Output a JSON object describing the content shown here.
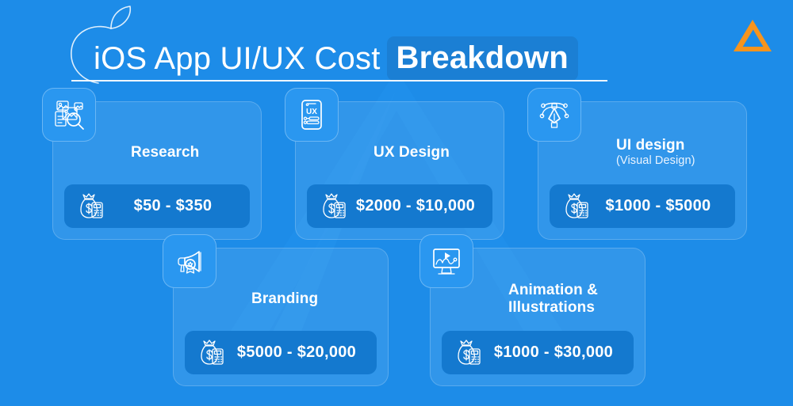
{
  "meta": {
    "background_color": "#1d8ce8",
    "accent_color": "#f7941d",
    "pill_color": "#1479cf",
    "icon_tile_color": "#2a97f0",
    "highlight_color": "#1b7fd4"
  },
  "header": {
    "apple_icon": "apple-logo-outline-icon",
    "title_light": "iOS App UI/UX Cost",
    "title_strong": "Breakdown",
    "brand_logo_icon": "orange-triangle-logo-icon"
  },
  "background": {
    "watermark_icon": "large-triangle-watermark-icon"
  },
  "cards": [
    {
      "id": "research",
      "icon": "research-document-magnifier-icon",
      "title": "Research",
      "subtitle": "",
      "price_icon": "money-bag-calculator-icon",
      "price": "$50 - $350"
    },
    {
      "id": "ux-design",
      "icon": "mobile-ux-wireframe-icon",
      "title": "UX Design",
      "subtitle": "",
      "price_icon": "money-bag-calculator-icon",
      "price": "$2000 - $10,000"
    },
    {
      "id": "ui-design",
      "icon": "pen-tool-bezier-icon",
      "title": "UI design",
      "subtitle": "(Visual Design)",
      "price_icon": "money-bag-calculator-icon",
      "price": "$1000 - $5000"
    },
    {
      "id": "branding",
      "icon": "megaphone-badge-icon",
      "title": "Branding",
      "subtitle": "",
      "price_icon": "money-bag-calculator-icon",
      "price": "$5000 - $20,000"
    },
    {
      "id": "animation-illustrations",
      "icon": "monitor-play-animation-icon",
      "title": "Animation &",
      "title_line2": "Illustrations",
      "subtitle": "",
      "price_icon": "money-bag-calculator-icon",
      "price": "$1000 - $30,000"
    }
  ]
}
